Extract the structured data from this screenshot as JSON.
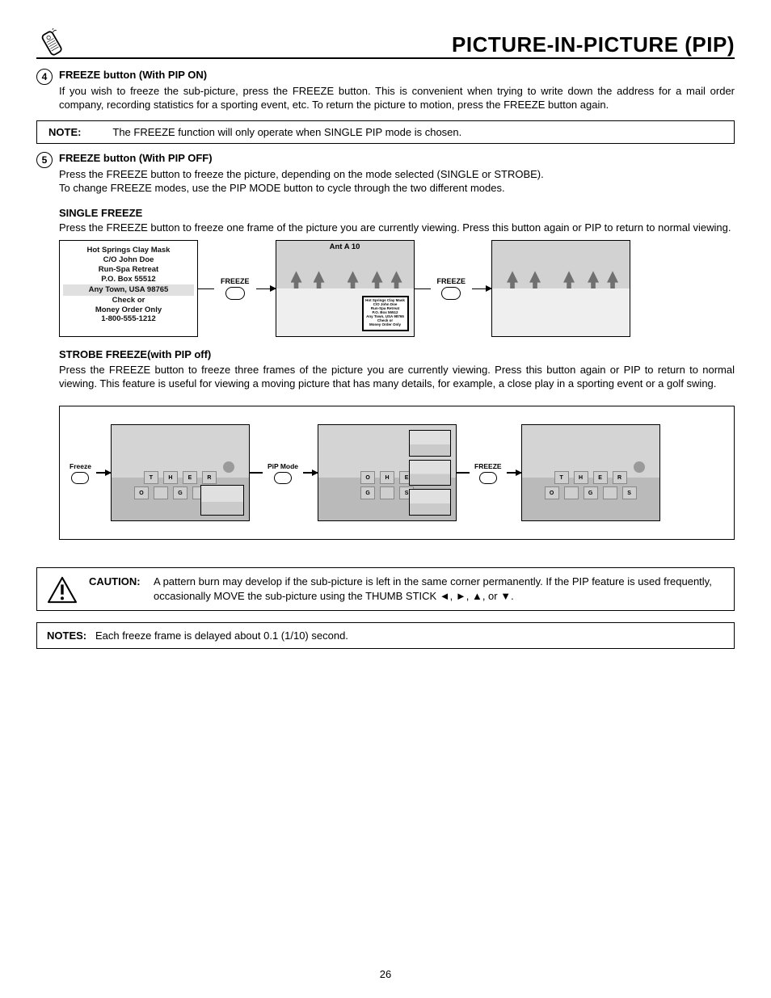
{
  "page_title": "PICTURE-IN-PICTURE (PIP)",
  "step4_num": "4",
  "step4_title": "FREEZE button (With PIP ON)",
  "step4_body": "If you wish to freeze the sub-picture, press the FREEZE button. This is convenient when trying to write down the address for a mail order company, recording statistics for a sporting event, etc.  To return the picture to motion, press the FREEZE button again.",
  "note_label": "NOTE:",
  "note_body": "The FREEZE function will only operate when SINGLE PIP mode is chosen.",
  "step5_num": "5",
  "step5_title": "FREEZE button (With PIP OFF)",
  "step5_line1": "Press the FREEZE button to freeze the picture, depending on the mode selected (SINGLE or STROBE).",
  "step5_line2": "To change FREEZE modes, use the PIP MODE button to cycle through the two different modes.",
  "single_title": "SINGLE FREEZE",
  "single_body": "Press the FREEZE button to freeze one frame of the picture you are currently viewing.  Press this button again or PIP to return to normal viewing.",
  "mail": {
    "l1": "Hot Springs Clay Mask",
    "l2": "C/O John Doe",
    "l3": "Run-Spa Retreat",
    "l4": "P.O. Box 55512",
    "l5": "Any Town, USA 98765",
    "l6": "Check or",
    "l7": "Money Order Only",
    "l8": "1-800-555-1212"
  },
  "freeze_label": "FREEZE",
  "ant_label": "Ant A 10",
  "strobe_title": "STROBE FREEZE(with PIP off)",
  "strobe_body": "Press the FREEZE button to freeze three frames of the picture you are currently viewing. Press this button again or PIP to return to normal viewing. This feature is useful for viewing a moving picture that has many details, for example, a close play in a sporting event or a golf swing.",
  "d2_freeze_l": "Freeze",
  "d2_pipmode": "PiP Mode",
  "d2_freeze_u": "FREEZE",
  "caution_label": "CAUTION:",
  "caution_body1": "A pattern burn may develop if the sub-picture is left in the same corner permanently.  If the PIP feature is used frequently, occasionally MOVE the sub-picture using the THUMB STICK ◄, ►, ▲, or ▼.",
  "notes_label": "NOTES:",
  "notes_body": "Each freeze frame is delayed about 0.1 (1/10) second.",
  "page_number": "26"
}
